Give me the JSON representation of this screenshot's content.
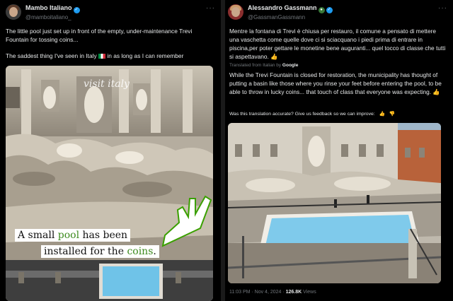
{
  "left_post": {
    "display_name": "Mambo Italiano",
    "handle": "@mamboitaliano_",
    "more_label": "···",
    "text_1": "The little pool just set up in front of the empty, under-maintenance Trevi Fountain for tossing coins...",
    "text_2_before_flag": "The saddest thing I've seen in Italy",
    "text_2_after_flag": "in as long as I can remember",
    "media": {
      "watermark": "visit italy",
      "caption_part1": "A small ",
      "caption_highlight1": "pool",
      "caption_part2": " has been",
      "caption_line2_part1": "installed for the ",
      "caption_highlight2": "coins",
      "caption_line2_end": "."
    }
  },
  "right_post": {
    "display_name": "Alessandro Gassmann",
    "handle": "@GassmanGassmann",
    "more_label": "···",
    "original_text": "Mentre la fontana di Trevi è chiusa per restauro, il comune a pensato di mettere una vaschetta come quelle dove ci si sciacquano i piedi prima di entrare in piscina,per poter gettare le monetine bene auguranti... quel tocco di classe che tutti si aspettavano.",
    "translated_label": "Translated from Italian by",
    "translated_provider": "Google",
    "translated_text": "While the Trevi Fountain is closed for restoration, the municipality has thought of putting a basin like those where you rinse your feet before entering the pool, to be able to throw in lucky coins... that touch of class that everyone was expecting.",
    "feedback_prompt": "Was this translation accurate? Give us feedback so we can improve:",
    "timestamp": "11:03 PM · Nov 4, 2024 · ",
    "views_count": "126.8K",
    "views_label": " Views"
  },
  "colors": {
    "background": "#000000",
    "text": "#e7e9ea",
    "muted": "#71767b",
    "verified": "#1d9bf0",
    "caption_highlight": "#3d8b1f",
    "pool_water": "#6fc3e8"
  }
}
